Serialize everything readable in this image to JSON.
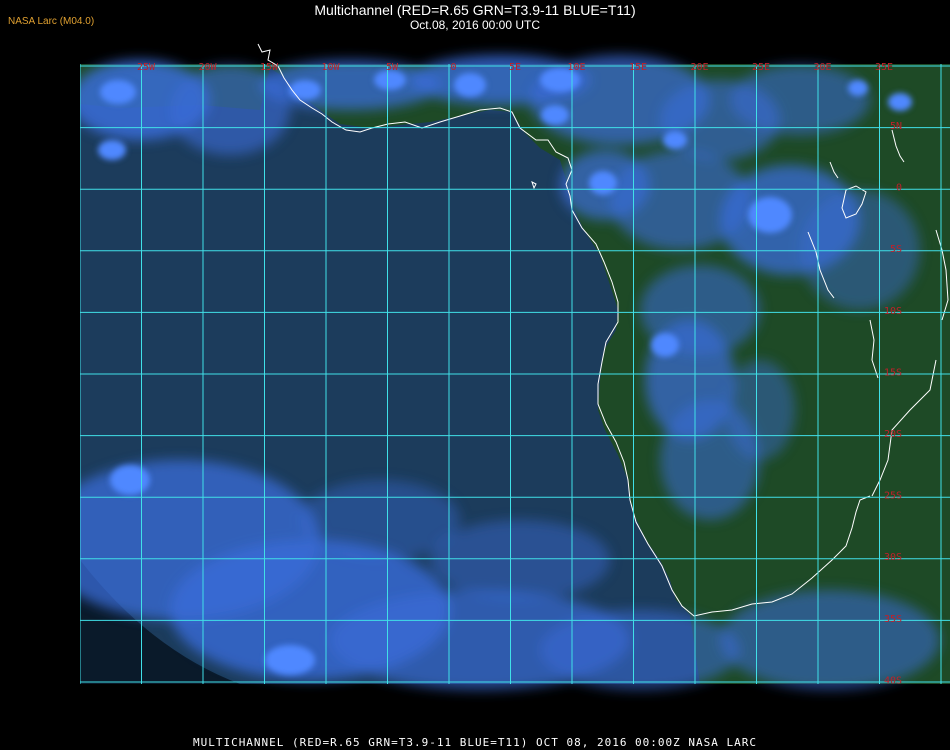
{
  "header": {
    "credit": "NASA Larc (M04.0)",
    "title": "Multichannel (RED=R.65 GRN=T3.9-11 BLUE=T11)",
    "subtitle": "Oct.08, 2016 00:00 UTC"
  },
  "footer": {
    "caption": "MULTICHANNEL (RED=R.65 GRN=T3.9-11 BLUE=T11) OCT 08, 2016 00:00Z   NASA LARC"
  },
  "map": {
    "grid_color": "#40e0e8",
    "coast_color": "#ffffff",
    "label_color": "#c0202a",
    "ocean_color": "#1c3c5c",
    "land_color": "#1e4a26",
    "cloud_color": "#3a6cd8",
    "longitude_labels": [
      "25W",
      "20W",
      "15W",
      "10W",
      "5W",
      "0",
      "5E",
      "10E",
      "15E",
      "20E",
      "25E",
      "30E",
      "35E"
    ],
    "latitude_labels": [
      "5N",
      "0",
      "5S",
      "10S",
      "15S",
      "20S",
      "25S",
      "30S",
      "35S",
      "40S"
    ]
  }
}
